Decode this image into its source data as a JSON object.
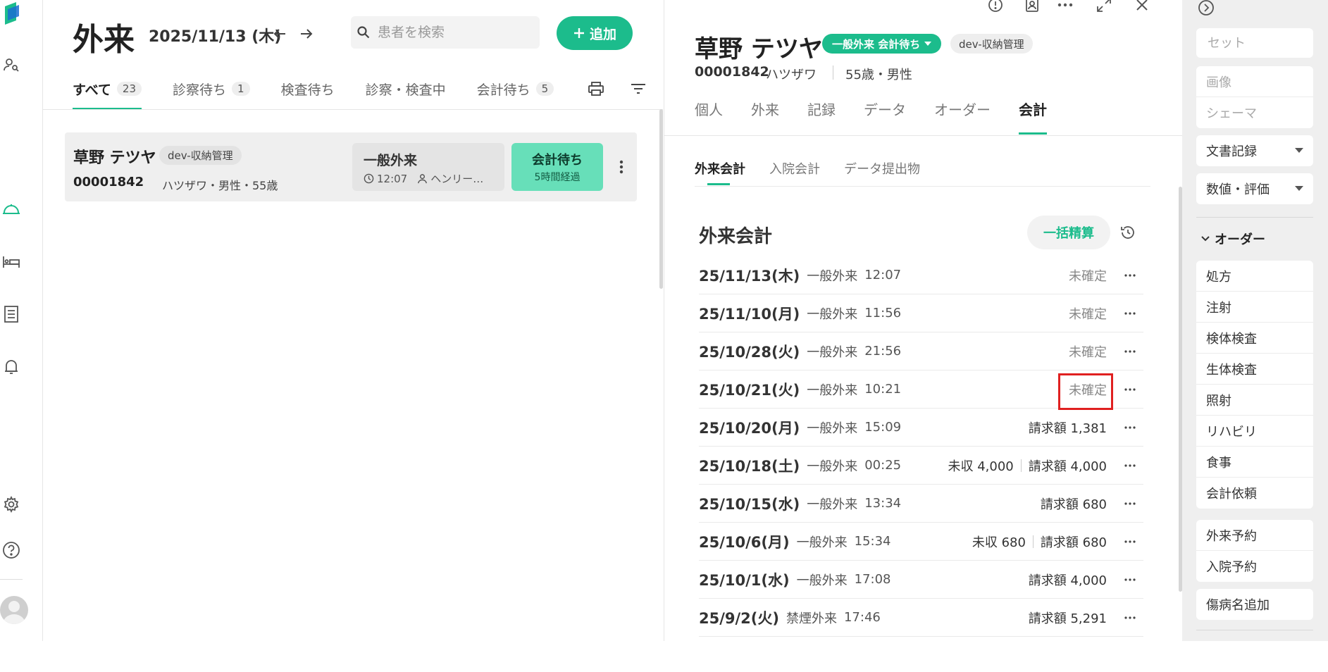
{
  "header": {
    "title": "外来",
    "date": "2025/11/13 (木)",
    "search_placeholder": "患者を検索",
    "add_label": "追加"
  },
  "tabs": [
    {
      "label": "すべて",
      "count": "23"
    },
    {
      "label": "診察待ち",
      "count": "1"
    },
    {
      "label": "検査待ち",
      "count": ""
    },
    {
      "label": "診察・検査中",
      "count": ""
    },
    {
      "label": "会計待ち",
      "count": "5"
    }
  ],
  "patient_card": {
    "name": "草野 テツヤ",
    "tag": "dev-収納管理",
    "id": "00001842",
    "meta": "ハツザワ・男性・55歳",
    "visit_type": "一般外来",
    "visit_time": "12:07",
    "doctor": "ヘンリー…",
    "status": "会計待ち",
    "status_sub": "5時間経過"
  },
  "detail": {
    "name": "草野 テツヤ",
    "status": "一般外来 会計待ち",
    "tag": "dev-収納管理",
    "id": "00001842",
    "kana": "ハツザワ",
    "age_sex": "55歳・男性",
    "tabs": [
      "個人",
      "外来",
      "記録",
      "データ",
      "オーダー",
      "会計"
    ],
    "active_tab": "会計",
    "sub_tabs": [
      "外来会計",
      "入院会計",
      "データ提出物"
    ],
    "section_title": "外来会計",
    "bulk_label": "一括精算",
    "rows": [
      {
        "date": "25/11/13(木)",
        "type": "一般外来",
        "time": "12:07",
        "unpaid": "",
        "status": "未確定"
      },
      {
        "date": "25/11/10(月)",
        "type": "一般外来",
        "time": "11:56",
        "unpaid": "",
        "status": "未確定"
      },
      {
        "date": "25/10/28(火)",
        "type": "一般外来",
        "time": "21:56",
        "unpaid": "",
        "status": "未確定"
      },
      {
        "date": "25/10/21(火)",
        "type": "一般外来",
        "time": "10:21",
        "unpaid": "",
        "status": "未確定"
      },
      {
        "date": "25/10/20(月)",
        "type": "一般外来",
        "time": "15:09",
        "unpaid": "",
        "status": "請求額 1,381"
      },
      {
        "date": "25/10/18(土)",
        "type": "一般外来",
        "time": "00:25",
        "unpaid": "未収 4,000",
        "status": "請求額 4,000"
      },
      {
        "date": "25/10/15(水)",
        "type": "一般外来",
        "time": "13:34",
        "unpaid": "",
        "status": "請求額 680"
      },
      {
        "date": "25/10/6(月)",
        "type": "一般外来",
        "time": "15:34",
        "unpaid": "未収 680",
        "status": "請求額 680"
      },
      {
        "date": "25/10/1(水)",
        "type": "一般外来",
        "time": "17:08",
        "unpaid": "",
        "status": "請求額 4,000"
      },
      {
        "date": "25/9/2(火)",
        "type": "禁煙外来",
        "time": "17:46",
        "unpaid": "",
        "status": "請求額 5,291"
      }
    ]
  },
  "right_panel": {
    "set_placeholder": "セット",
    "media_items": [
      "画像",
      "シェーマ"
    ],
    "doc_record": "文書記録",
    "numeric_eval": "数値・評価",
    "order_section": "オーダー",
    "order_items": [
      "処方",
      "注射",
      "検体検査",
      "生体検査",
      "照射",
      "リハビリ",
      "食事",
      "会計依頼"
    ],
    "reservation_items": [
      "外来予約",
      "入院予約"
    ],
    "disease_add": "傷病名追加"
  },
  "colors": {
    "accent": "#1cbc8c",
    "status_light": "#67dfb9",
    "highlight": "#e02020"
  }
}
